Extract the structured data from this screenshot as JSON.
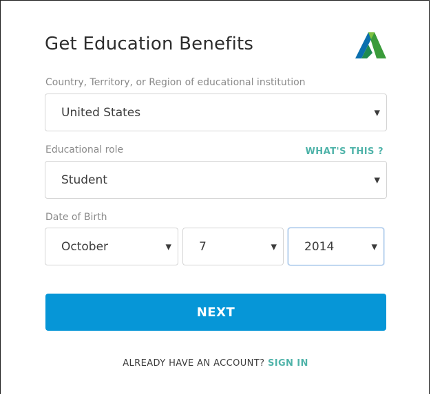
{
  "form": {
    "title": "Get Education Benefits",
    "country": {
      "label": "Country, Territory, or Region of educational institution",
      "value": "United States"
    },
    "role": {
      "label": "Educational role",
      "value": "Student",
      "help_link": "WHAT'S THIS ?"
    },
    "dob": {
      "label": "Date of Birth",
      "month": "October",
      "day": "7",
      "year": "2014"
    },
    "next_label": "NEXT",
    "signin_prompt": "ALREADY HAVE AN ACCOUNT?",
    "signin_link": "SIGN IN"
  },
  "icons": {
    "logo": "autodesk-logo-icon",
    "caret": "caret-down-icon"
  },
  "colors": {
    "primary": "#0696d7",
    "link": "#4fb3a9",
    "focus_border": "#9cbfe6"
  }
}
